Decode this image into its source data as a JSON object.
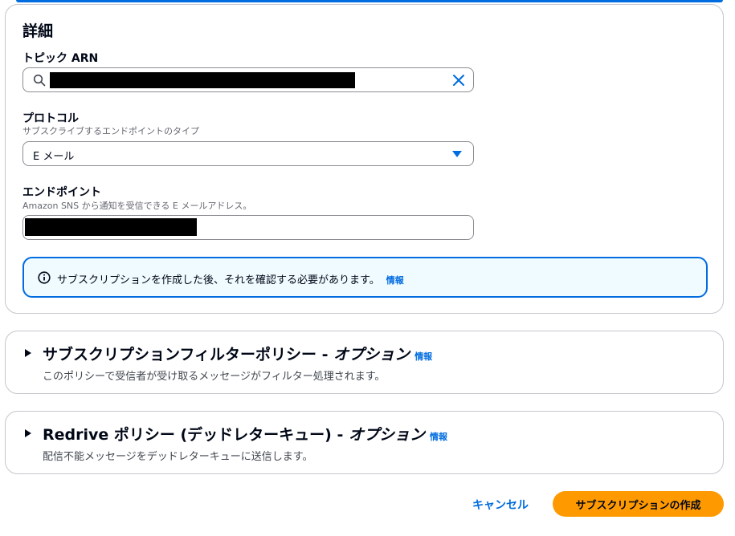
{
  "details": {
    "title": "詳細",
    "topic_arn": {
      "label": "トピック ARN"
    },
    "protocol": {
      "label": "プロトコル",
      "description": "サブスクライブするエンドポイントのタイプ",
      "value": "E メール"
    },
    "endpoint": {
      "label": "エンドポイント",
      "description": "Amazon SNS から通知を受信できる E メールアドレス。"
    },
    "alert": {
      "text": "サブスクリプションを作成した後、それを確認する必要があります。",
      "info_link": "情報"
    }
  },
  "filter_policy": {
    "title_main": "サブスクリプションフィルターポリシー - ",
    "title_option": "オプション",
    "info_link": "情報",
    "description": "このポリシーで受信者が受け取るメッセージがフィルター処理されます。"
  },
  "redrive_policy": {
    "title_main": "Redrive ポリシー (デッドレターキュー) - ",
    "title_option": "オプション",
    "info_link": "情報",
    "description": "配信不能メッセージをデッドレターキューに送信します。"
  },
  "actions": {
    "cancel": "キャンセル",
    "create": "サブスクリプションの作成"
  },
  "colors": {
    "accent": "#006ce0",
    "primary_button": "#ff9900",
    "alert_background": "#f0fbff"
  }
}
